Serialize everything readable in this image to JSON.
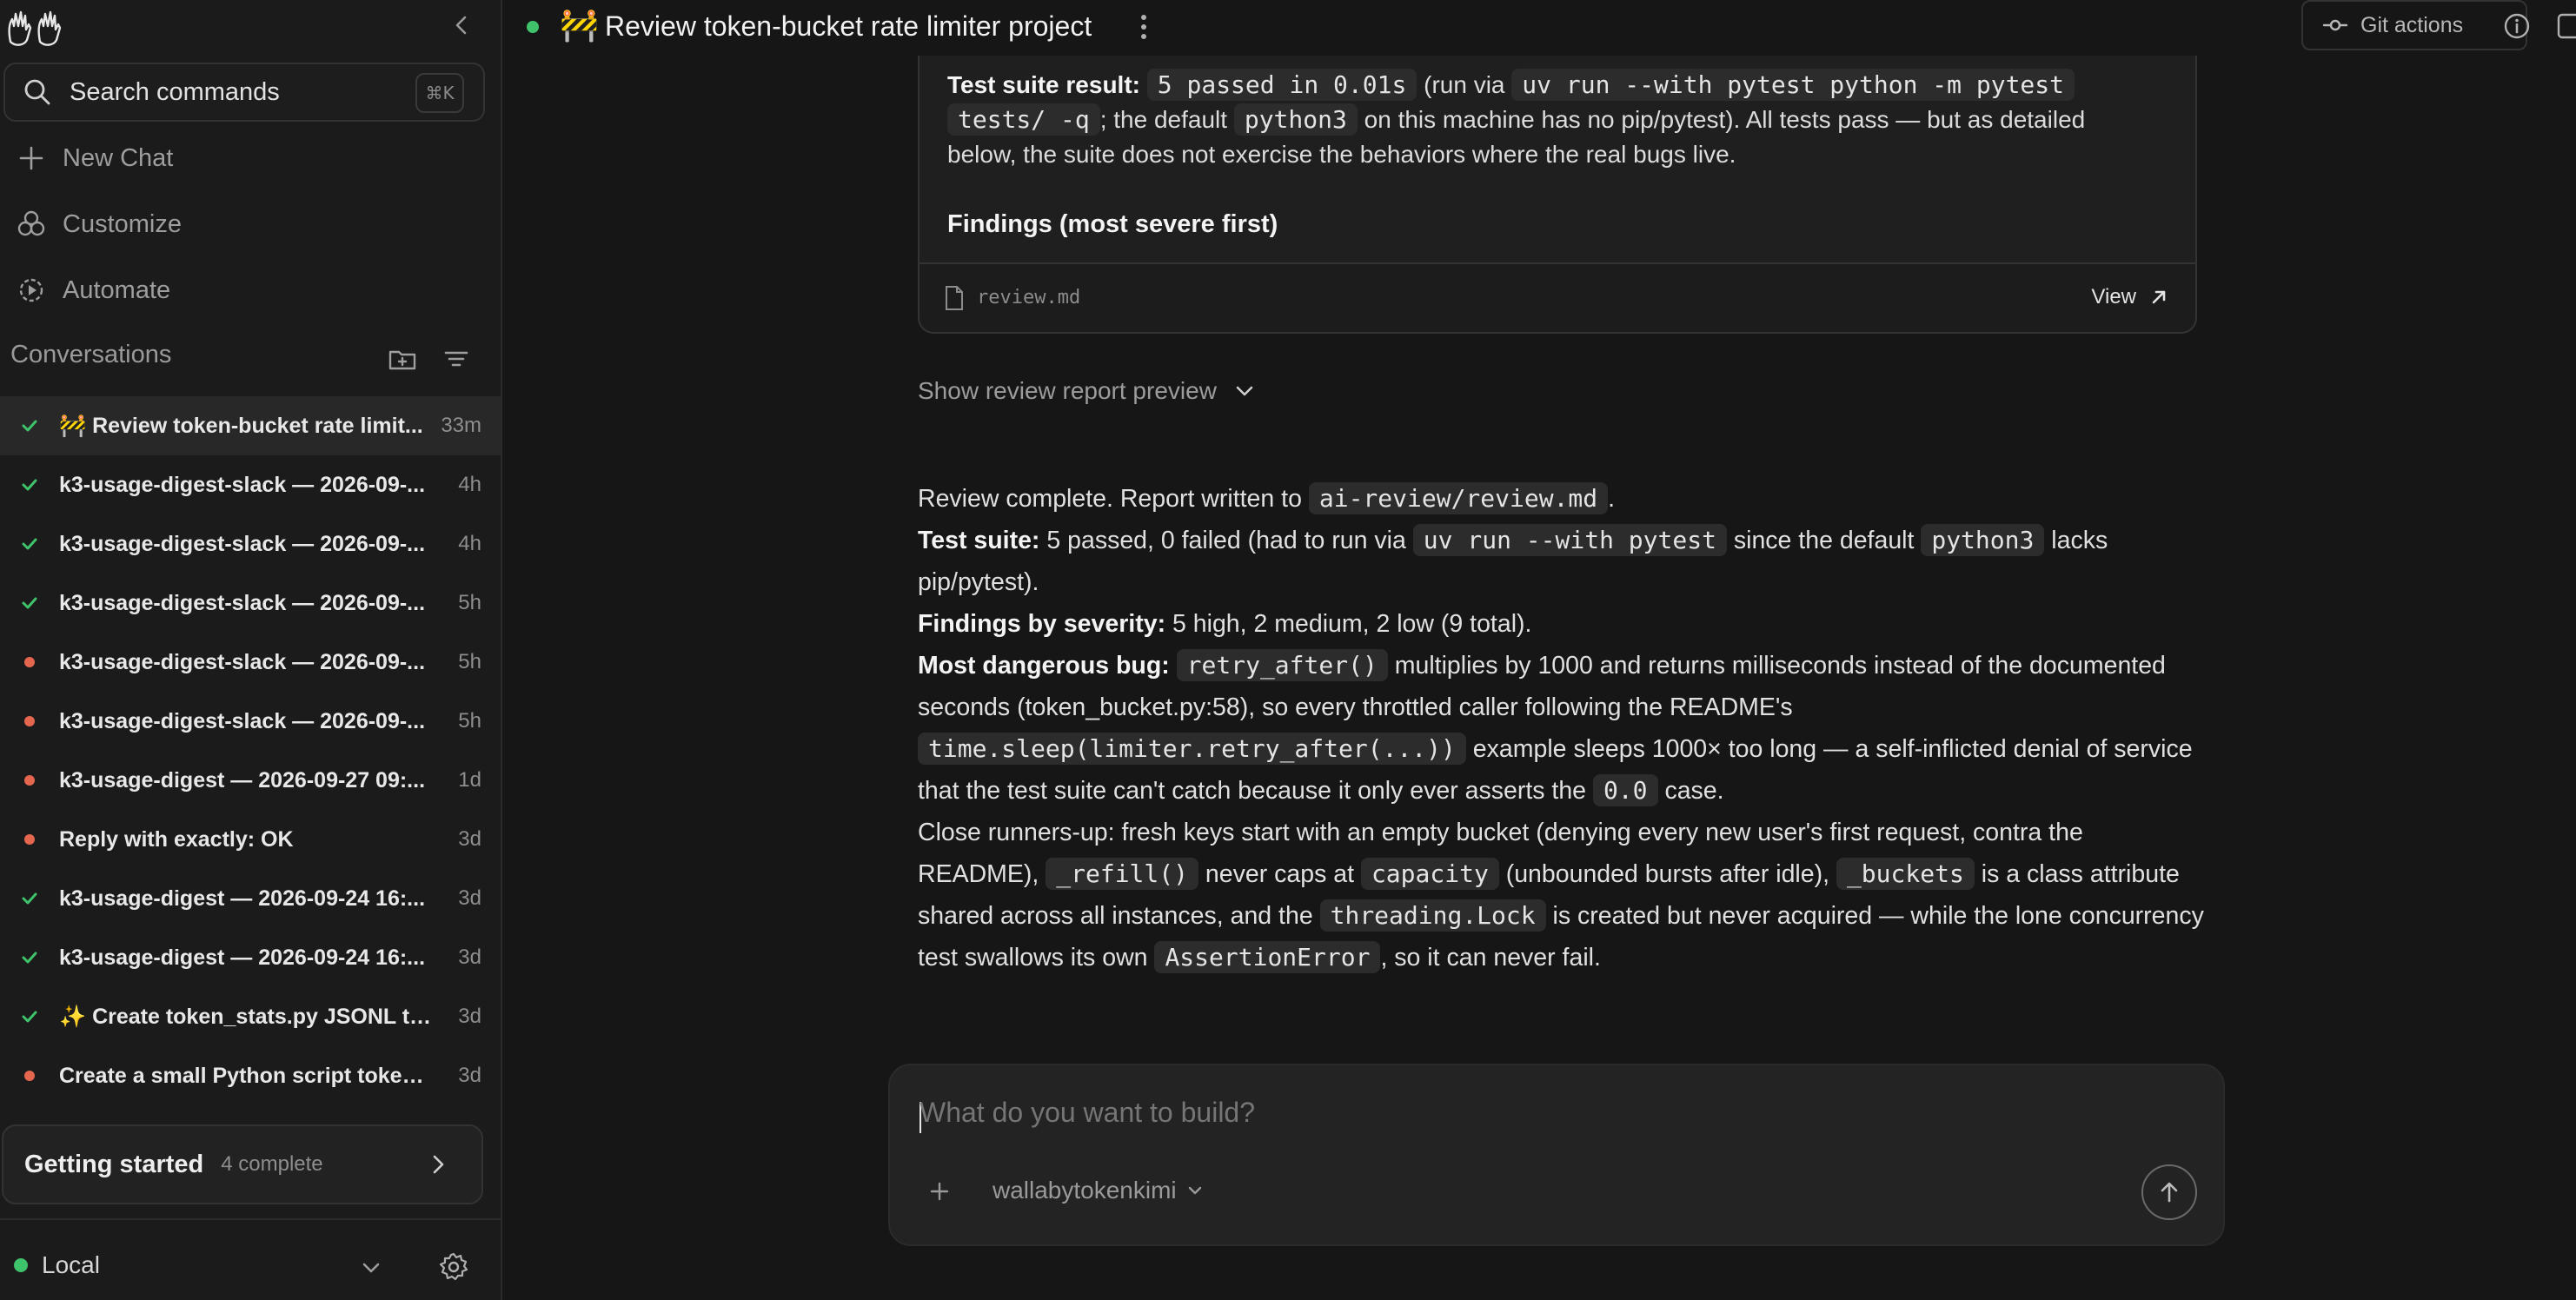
{
  "sidebar": {
    "search": {
      "label": "Search commands",
      "shortcut": "⌘K"
    },
    "nav": {
      "new_chat": "New Chat",
      "customize": "Customize",
      "automate": "Automate"
    },
    "conversations_label": "Conversations",
    "conversations": [
      {
        "status": "done",
        "title": "🚧 Review token-bucket rate limit...",
        "age": "33m",
        "active": true
      },
      {
        "status": "done",
        "title": "k3-usage-digest-slack — 2026-09-...",
        "age": "4h"
      },
      {
        "status": "done",
        "title": "k3-usage-digest-slack — 2026-09-...",
        "age": "4h"
      },
      {
        "status": "done",
        "title": "k3-usage-digest-slack — 2026-09-...",
        "age": "5h"
      },
      {
        "status": "error",
        "title": "k3-usage-digest-slack — 2026-09-...",
        "age": "5h"
      },
      {
        "status": "error",
        "title": "k3-usage-digest-slack — 2026-09-...",
        "age": "5h"
      },
      {
        "status": "error",
        "title": "k3-usage-digest — 2026-09-27 09:...",
        "age": "1d"
      },
      {
        "status": "error",
        "title": "Reply with exactly: OK",
        "age": "3d"
      },
      {
        "status": "done",
        "title": "k3-usage-digest — 2026-09-24 16:...",
        "age": "3d"
      },
      {
        "status": "done",
        "title": "k3-usage-digest — 2026-09-24 16:...",
        "age": "3d"
      },
      {
        "status": "done",
        "title": "✨ Create token_stats.py JSONL tok...",
        "age": "3d"
      },
      {
        "status": "error",
        "title": "Create a small Python script token_s...",
        "age": "3d"
      }
    ],
    "getting_started": {
      "title": "Getting started",
      "count": "4 complete"
    },
    "environment": "Local"
  },
  "header": {
    "emoji": "🚧",
    "title": "Review token-bucket rate limiter project",
    "git_actions": "Git actions"
  },
  "card": {
    "line1_bold": "Test suite result:",
    "line1_code": "5 passed in 0.01s",
    "line1_text": "(run via",
    "line1_code2": "uv run --with pytest python -m pytest",
    "line2_code": "tests/ -q",
    "line2_text": "; the default",
    "line2_code2": "python3",
    "line2_text2": "on this machine has no pip/pytest). All tests pass — but as detailed",
    "line3_text": "below, the suite does not exercise the behaviors where the real bugs live.",
    "findings": "Findings (most severe first)",
    "file_name": "review.md",
    "view_label": "View"
  },
  "preview_toggle": "Show review report preview",
  "message": {
    "p1_text": "Review complete. Report written to",
    "p1_code": "ai-review/review.md",
    "p1_end": ".",
    "p2_bold": "Test suite:",
    "p2_text": "5 passed, 0 failed (had to run via",
    "p2_code": "uv run --with pytest",
    "p2_text2": "since the default",
    "p2_code2": "python3",
    "p2_text3": "lacks pip/pytest).",
    "p3_bold": "Findings by severity:",
    "p3_text": "5 high, 2 medium, 2 low (9 total).",
    "p4_bold": "Most dangerous bug:",
    "p4_code": "retry_after()",
    "p4_text": "multiplies by 1000 and returns milliseconds instead of the documented seconds (token_bucket.py:58), so every throttled caller following the README's",
    "p4_code2": "time.sleep(limiter.retry_after(...))",
    "p4_text2": "example sleeps 1000× too long — a self-inflicted denial of service that the test suite can't catch because it only ever asserts the",
    "p4_code3": "0.0",
    "p4_text3": "case.",
    "p5_text": "Close runners-up: fresh keys start with an empty bucket (denying every new user's first request, contra the README),",
    "p5_code": "_refill()",
    "p5_text2": "never caps at",
    "p5_code2": "capacity",
    "p5_text3": "(unbounded bursts after idle),",
    "p5_code3": "_buckets",
    "p5_text4": "is a class attribute shared across all instances, and the",
    "p5_code4": "threading.Lock",
    "p5_text5": "is created but never acquired — while the lone concurrency test swallows its own",
    "p5_code5": "AssertionError",
    "p5_text6": ", so it can never fail."
  },
  "composer": {
    "placeholder": "What do you want to build?",
    "model": "wallabytokenkimi"
  },
  "colors": {
    "success": "#3ec36a",
    "error": "#e5664e",
    "background": "#161616",
    "sidebar": "#1b1b1b"
  }
}
